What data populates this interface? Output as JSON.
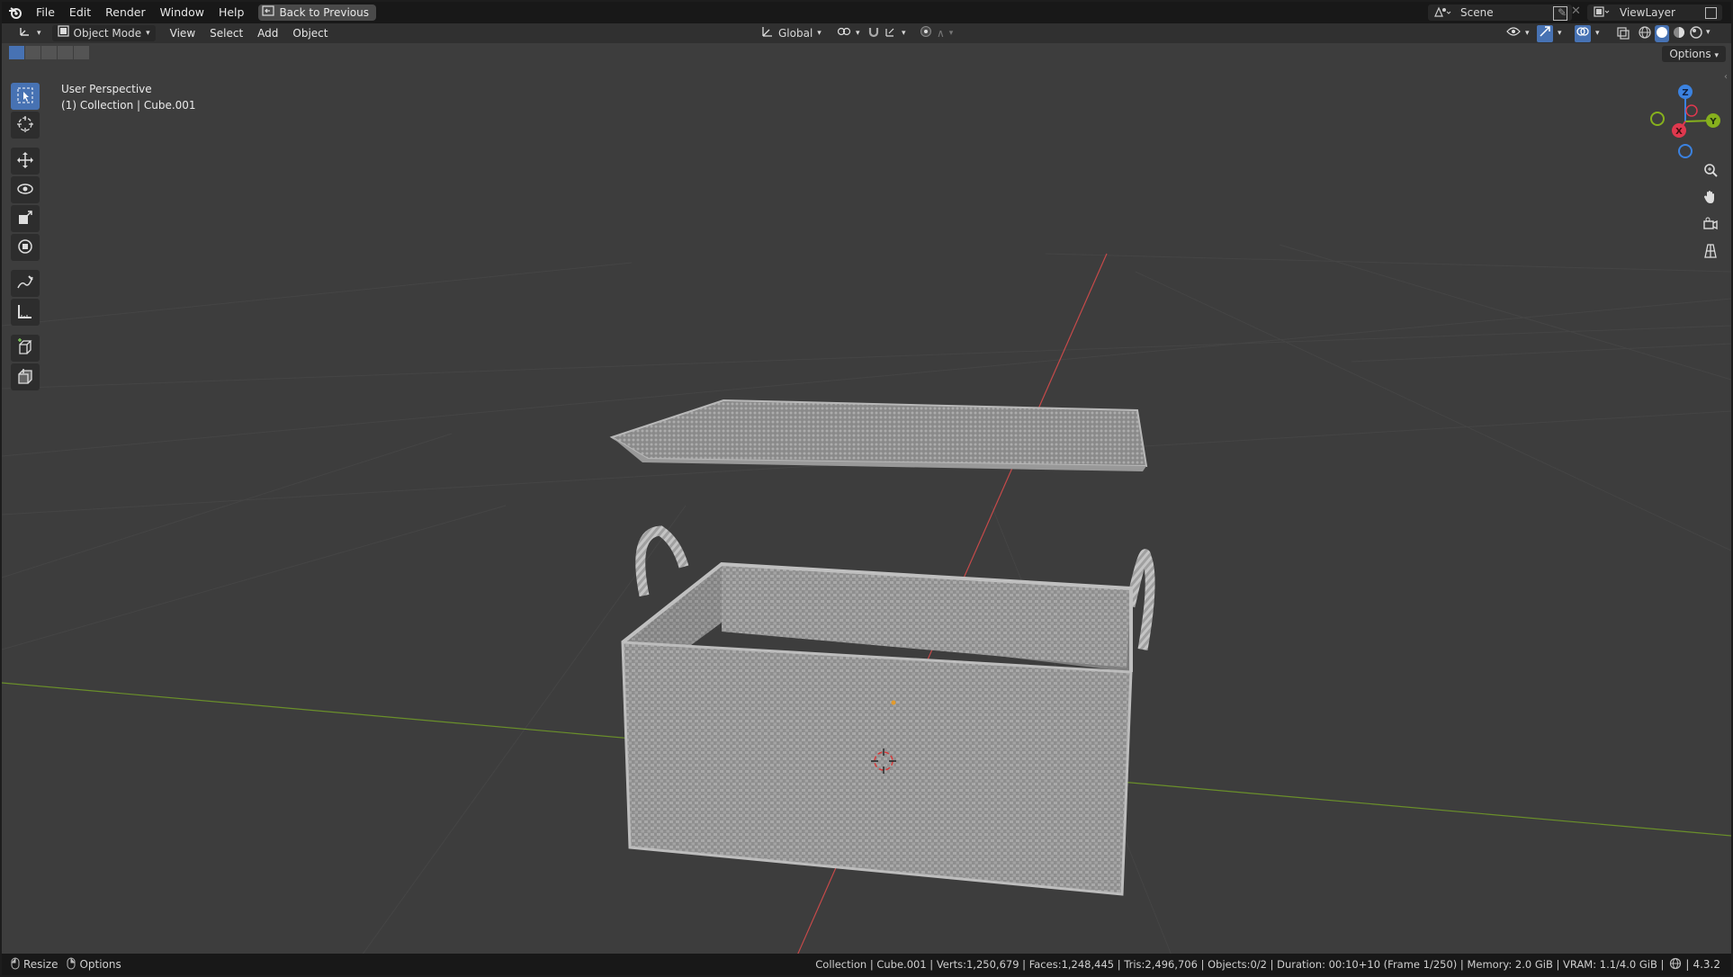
{
  "menu": {
    "file": "File",
    "edit": "Edit",
    "render": "Render",
    "window": "Window",
    "help": "Help",
    "back_to_previous": "Back to Previous"
  },
  "scene": {
    "label": "Scene"
  },
  "view_layer": {
    "label": "ViewLayer"
  },
  "header": {
    "mode": "Object Mode",
    "view": "View",
    "select": "Select",
    "add": "Add",
    "object": "Object",
    "orientation": "Global",
    "options": "Options"
  },
  "viewport": {
    "perspective": "User Perspective",
    "collection_info": "(1) Collection | Cube.001"
  },
  "gizmo": {
    "z": "Z",
    "y": "Y",
    "x": "X"
  },
  "tools": [
    {
      "name": "select-box-tool",
      "icon": "select-box-icon",
      "active": true
    },
    {
      "name": "cursor-tool",
      "icon": "cursor-icon"
    },
    {
      "name": "move-tool",
      "icon": "move-icon"
    },
    {
      "name": "rotate-tool",
      "icon": "rotate-icon"
    },
    {
      "name": "scale-tool",
      "icon": "scale-icon"
    },
    {
      "name": "transform-tool",
      "icon": "transform-icon"
    },
    {
      "name": "annotate-tool",
      "icon": "annotate-icon"
    },
    {
      "name": "measure-tool",
      "icon": "measure-icon"
    },
    {
      "name": "add-cube-tool",
      "icon": "add-cube-icon"
    },
    {
      "name": "extrude-tool",
      "icon": "extrude-icon"
    }
  ],
  "status": {
    "resize": "Resize",
    "options": "Options",
    "stats": "Collection | Cube.001 | Verts:1,250,679 | Faces:1,248,445 | Tris:2,496,706 | Objects:0/2 | Duration: 00:10+10 (Frame 1/250) | Memory: 2.0 GiB | VRAM: 1.1/4.0 GiB |",
    "version": "4.3.2"
  },
  "colors": {
    "accent": "#4772b3",
    "x_axis": "#e0384e",
    "y_axis": "#86b01d",
    "z_axis": "#3b82e0",
    "viewport_bg": "#3d3d3d"
  }
}
